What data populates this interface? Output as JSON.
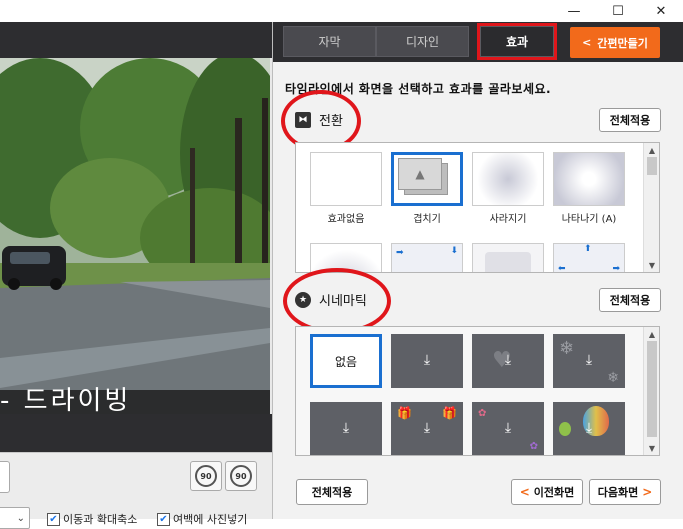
{
  "window": {
    "minimize": "—",
    "maximize": "☐",
    "close": "✕"
  },
  "tabs": [
    {
      "label": "자막"
    },
    {
      "label": "디자인"
    },
    {
      "label": "효과"
    }
  ],
  "quick_make": {
    "label": "간편만들기",
    "chevron": "<"
  },
  "instruction": "타임라인에서 화면을 선택하고 효과를 골라보세요.",
  "transition": {
    "title": "전환",
    "apply_label": "전체적용",
    "items": [
      {
        "label": "효과없음"
      },
      {
        "label": "겹치기"
      },
      {
        "label": "사라지기"
      },
      {
        "label": "나타나기 (A)"
      }
    ]
  },
  "cinematic": {
    "title": "시네마틱",
    "apply_label": "전체적용",
    "none_label": "없음"
  },
  "preview": {
    "caption": "- 드라이빙",
    "rotate_left": "90",
    "rotate_right": "90",
    "option_move_zoom": "이동과 확대축소",
    "option_fill_photo": "여백에 사진넣기",
    "check_mark": "✔",
    "select_arrow": "⌄"
  },
  "footer": {
    "apply_all": "전체적용",
    "prev_label": "이전화면",
    "next_label": "다음화면",
    "prev_chev": "<",
    "next_chev": ">"
  },
  "colors": {
    "accent_orange": "#f26a1b",
    "selection_blue": "#1a6fd0",
    "annotation_red": "#e0161b",
    "dark_bar": "#2d2d30"
  }
}
